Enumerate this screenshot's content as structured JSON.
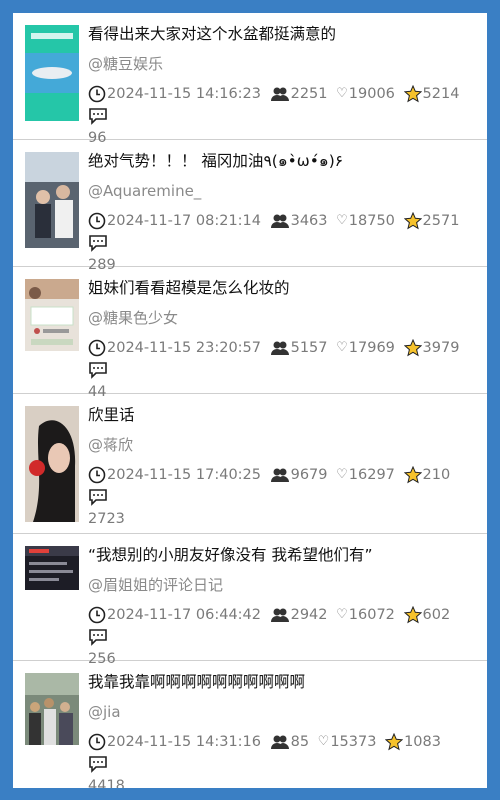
{
  "posts": [
    {
      "title": "看得出来大家对这个水盆都挺满意的",
      "author": "@糖豆娱乐",
      "time": "2024-11-15 14:16:23",
      "views": "2251",
      "likes": "19006",
      "stars": "5214",
      "comments": "96",
      "thumb_bg": "#25c6a8",
      "thumb_accent": "#4aa3e0"
    },
    {
      "title": "绝对气势！！！ 福冈加油٩(๑•̀ω•́๑)۶",
      "author": "@Aquaremine_",
      "time": "2024-11-17 08:21:14",
      "views": "3463",
      "likes": "18750",
      "stars": "2571",
      "comments": "289",
      "thumb_bg": "#5a6470",
      "thumb_accent": "#c9d4de"
    },
    {
      "title": "姐妹们看看超模是怎么化妆的",
      "author": "@糖果色少女",
      "time": "2024-11-15 23:20:57",
      "views": "5157",
      "likes": "17969",
      "stars": "3979",
      "comments": "44",
      "thumb_bg": "#e8e2da",
      "thumb_accent": "#c0504d"
    },
    {
      "title": "欣里话",
      "author": "@蒋欣",
      "time": "2024-11-15 17:40:25",
      "views": "9679",
      "likes": "16297",
      "stars": "210",
      "comments": "2723",
      "thumb_bg": "#d9cfc4",
      "thumb_accent": "#d12a2a"
    },
    {
      "title": "“我想别的小朋友好像没有 我希望他们有”",
      "author": "@眉姐姐的评论日记",
      "time": "2024-11-17 06:44:42",
      "views": "2942",
      "likes": "16072",
      "stars": "602",
      "comments": "256",
      "thumb_bg": "#1d1d26",
      "thumb_accent": "#e0403a"
    },
    {
      "title": "我靠我靠啊啊啊啊啊啊啊啊啊啊",
      "author": "@jia",
      "time": "2024-11-15 14:31:16",
      "views": "85",
      "likes": "15373",
      "stars": "1083",
      "comments": "4418",
      "thumb_bg": "#7b8a7a",
      "thumb_accent": "#caa57a"
    }
  ]
}
